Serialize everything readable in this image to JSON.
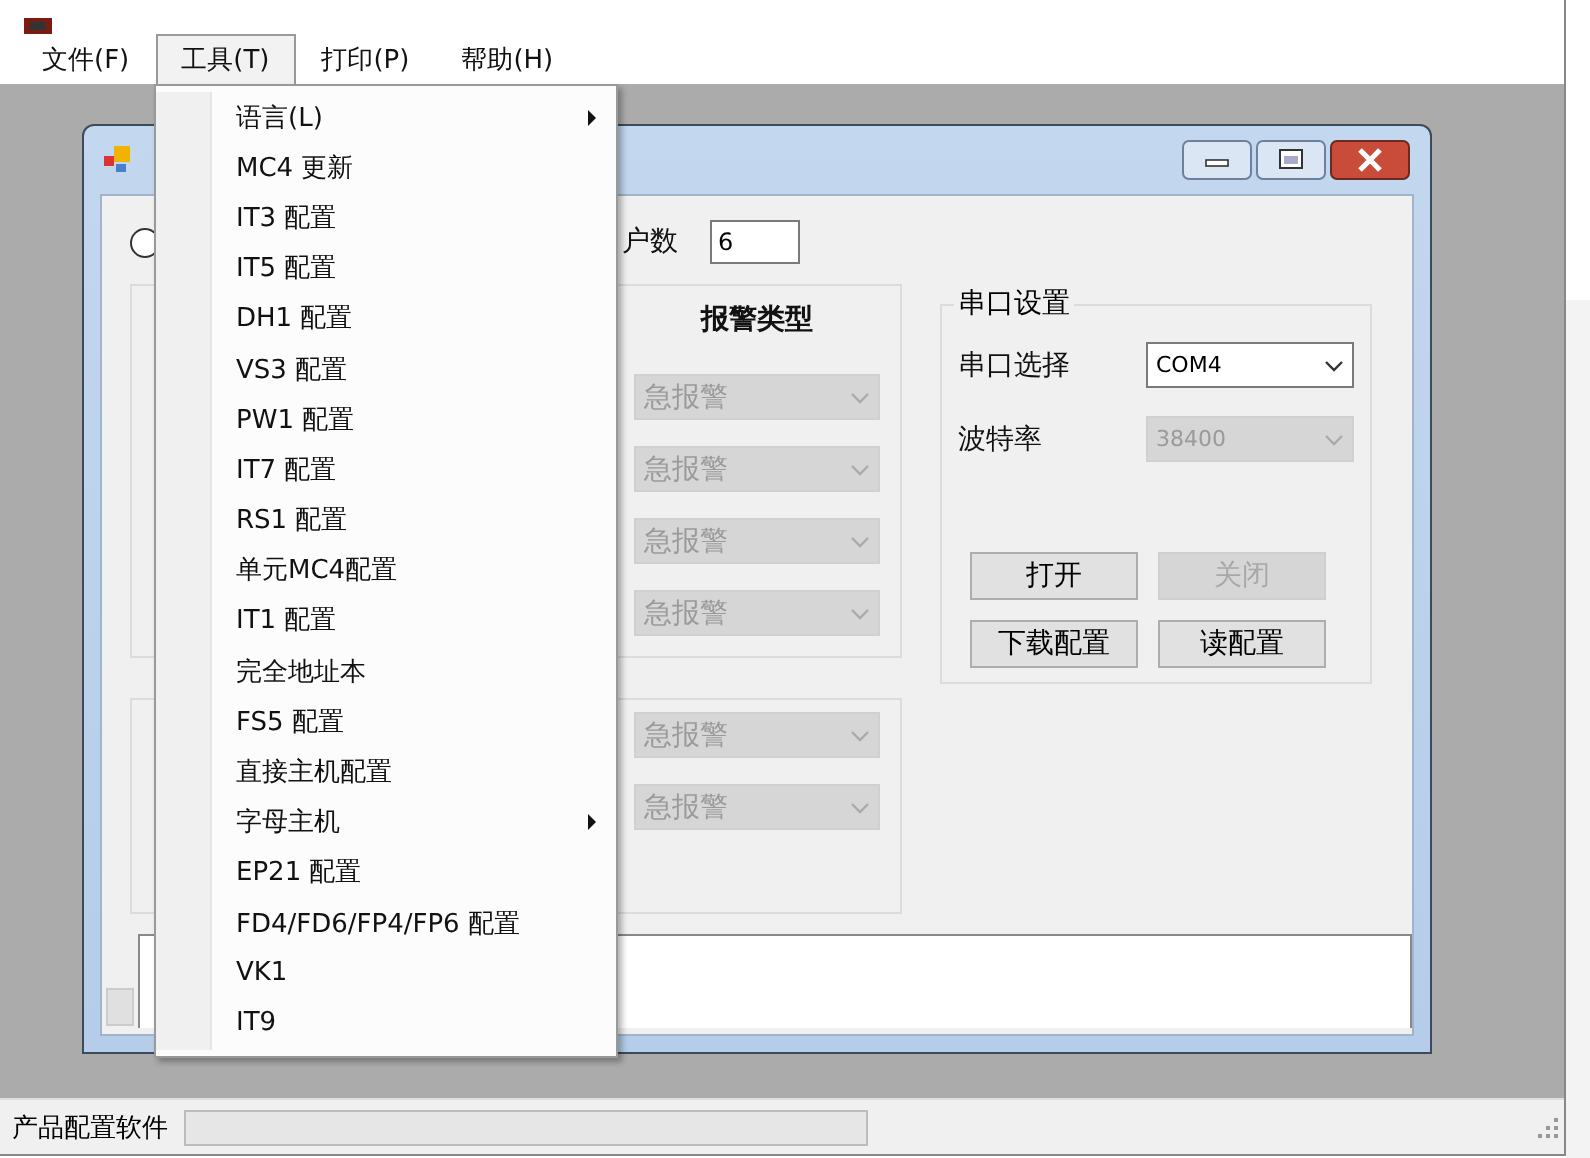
{
  "menu_bar": [
    {
      "label": "文件(F)",
      "selected": false
    },
    {
      "label": "工具(T)",
      "selected": true
    },
    {
      "label": "打印(P)",
      "selected": false
    },
    {
      "label": "帮助(H)",
      "selected": false
    }
  ],
  "tools_menu": {
    "items": [
      {
        "label": "语言(L)",
        "submenu": true
      },
      {
        "label": "MC4 更新",
        "submenu": false
      },
      {
        "label": "IT3 配置",
        "submenu": false
      },
      {
        "label": "IT5 配置",
        "submenu": false
      },
      {
        "label": "DH1 配置",
        "submenu": false
      },
      {
        "label": "VS3 配置",
        "submenu": false
      },
      {
        "label": "PW1 配置",
        "submenu": false
      },
      {
        "label": "IT7 配置",
        "submenu": false
      },
      {
        "label": "RS1 配置",
        "submenu": false
      },
      {
        "label": "单元MC4配置",
        "submenu": false
      },
      {
        "label": "IT1 配置",
        "submenu": false
      },
      {
        "label": "完全地址本",
        "submenu": false
      },
      {
        "label": "FS5 配置",
        "submenu": false
      },
      {
        "label": "直接主机配置",
        "submenu": false
      },
      {
        "label": "字母主机",
        "submenu": true
      },
      {
        "label": "EP21 配置",
        "submenu": false
      },
      {
        "label": "FD4/FD6/FP4/FP6 配置",
        "submenu": false
      },
      {
        "label": "VK1",
        "submenu": false
      },
      {
        "label": "IT9",
        "submenu": false
      }
    ]
  },
  "child_window": {
    "radio": {
      "selected": false
    },
    "count": {
      "label": "户数",
      "value": "6"
    },
    "alarm_group": {
      "header": "报警类型",
      "combos": [
        {
          "value": "急报警",
          "disabled": true
        },
        {
          "value": "急报警",
          "disabled": true
        },
        {
          "value": "急报警",
          "disabled": true
        },
        {
          "value": "急报警",
          "disabled": true
        }
      ]
    },
    "alarm_group_2": {
      "combos": [
        {
          "value": "急报警",
          "disabled": true
        },
        {
          "value": "急报警",
          "disabled": true
        }
      ]
    },
    "serial": {
      "title": "串口设置",
      "port": {
        "label": "串口选择",
        "value": "COM4",
        "disabled": false
      },
      "baud": {
        "label": "波特率",
        "value": "38400",
        "disabled": true
      },
      "buttons": [
        {
          "label": "打开",
          "disabled": false
        },
        {
          "label": "关闭",
          "disabled": true
        },
        {
          "label": "下载配置",
          "disabled": false
        },
        {
          "label": "读配置",
          "disabled": false
        }
      ]
    }
  },
  "status_bar": {
    "text": "产品配置软件",
    "progress": {
      "level": 0
    }
  }
}
